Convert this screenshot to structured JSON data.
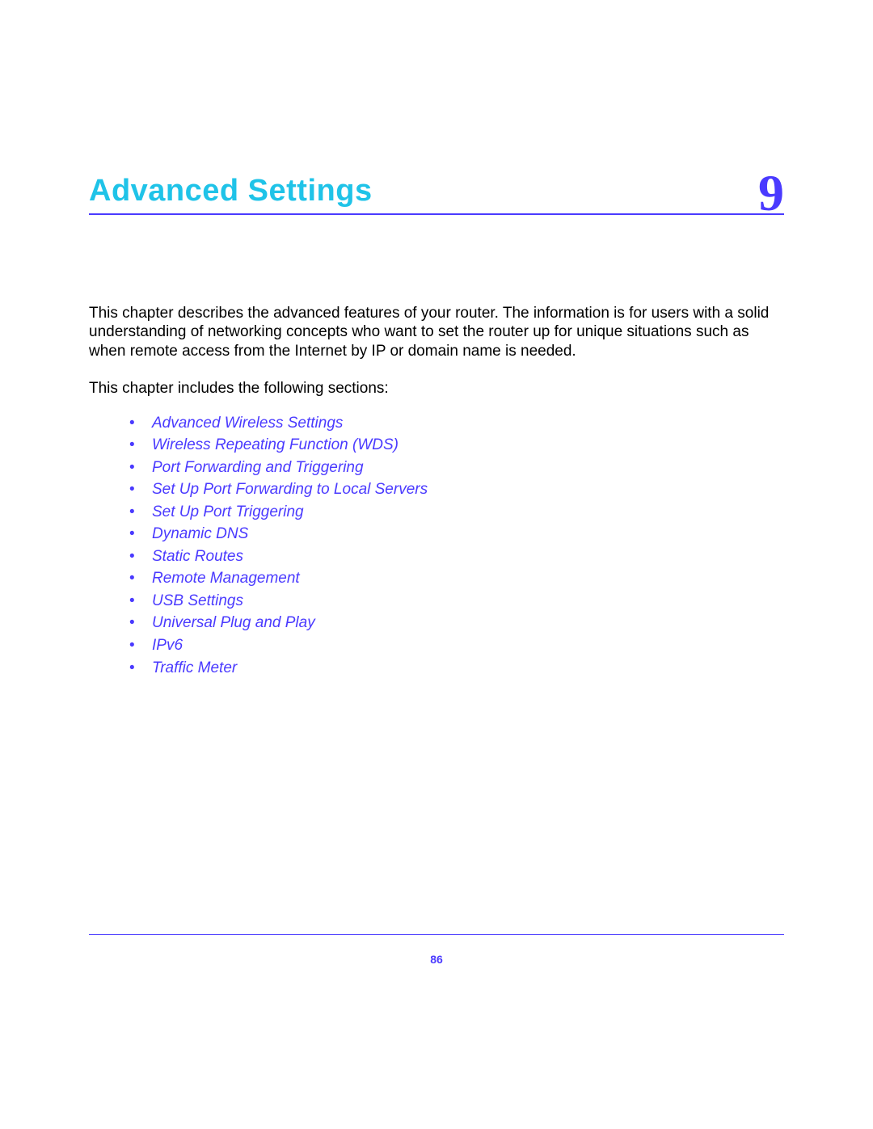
{
  "chapter": {
    "title": "Advanced Settings",
    "number": "9"
  },
  "intro": "This chapter describes the advanced features of your router. The information is for users with a solid understanding of networking concepts who want to set the router up for unique situations such as when remote access from the Internet by IP or domain name is needed.",
  "sections_intro": "This chapter includes the following sections:",
  "sections": [
    "Advanced Wireless Settings",
    "Wireless Repeating Function (WDS)",
    "Port Forwarding and Triggering",
    "Set Up Port Forwarding to Local Servers",
    "Set Up Port Triggering",
    "Dynamic DNS",
    "Static Routes",
    "Remote Management",
    "USB Settings",
    "Universal Plug and Play",
    "IPv6",
    "Traffic Meter"
  ],
  "page_number": "86"
}
